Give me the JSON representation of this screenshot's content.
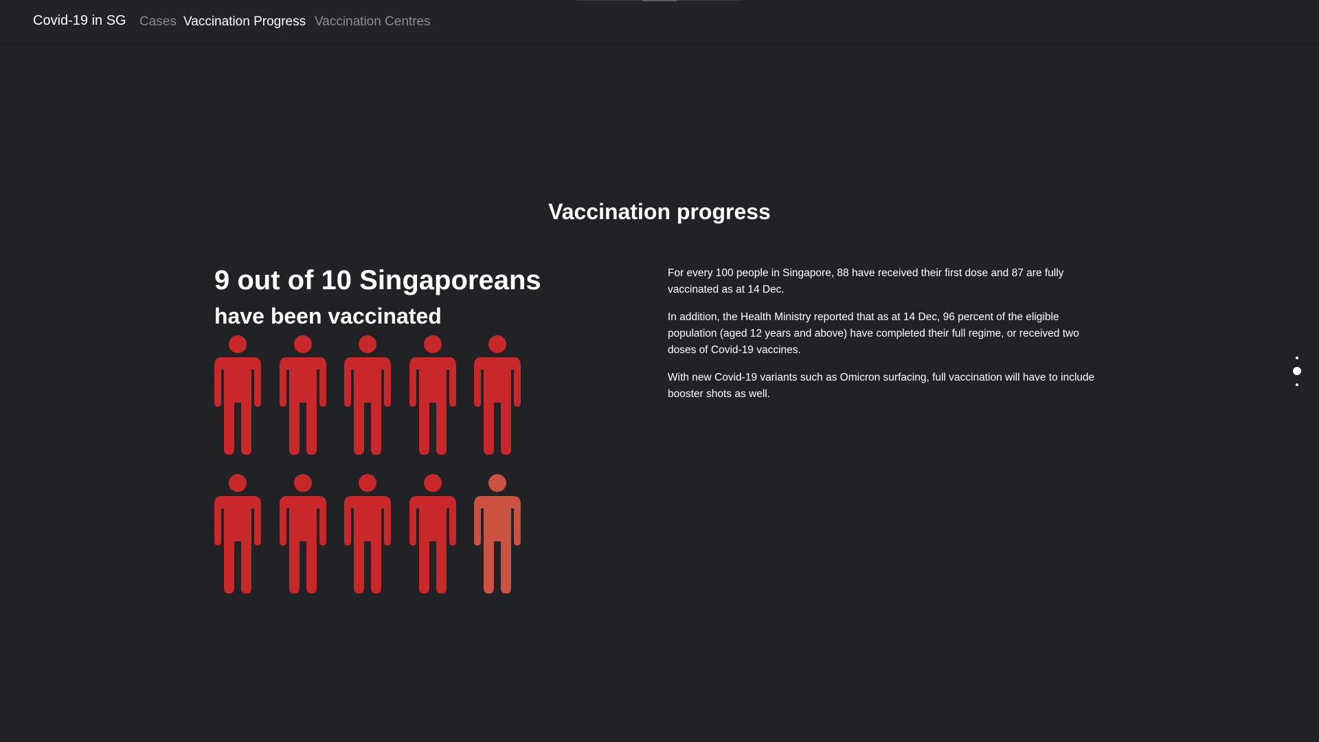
{
  "nav": {
    "brand": "Covid-19 in SG",
    "links": [
      {
        "label": "Cases",
        "active": false
      },
      {
        "label": "Vaccination Progress",
        "active": true
      },
      {
        "label": "Vaccination Centres",
        "active": false
      }
    ]
  },
  "section": {
    "title": "Vaccination progress",
    "headline": "9 out of 10 Singaporeans",
    "subheadline": "have been vaccinated"
  },
  "pictogram": {
    "total": 10,
    "vaccinated": 9,
    "icon": "person-icon",
    "colors": {
      "vaccinated": "#c8282a",
      "unvaccinated": "#c95340"
    }
  },
  "paragraphs": [
    "For every 100 people in Singapore, 88 have received their first dose and 87 are fully vaccinated as at 14 Dec.",
    "In addition, the Health Ministry reported that as at 14 Dec, 96 percent of the eligible population (aged 12 years and above) have completed their full regime, or received two doses of Covid-19 vaccines.",
    "With new Covid-19 variants such as Omicron surfacing, full vaccination will have to include booster shots as well."
  ],
  "page_dots": {
    "count": 3,
    "active_index": 1
  },
  "colors": {
    "background": "#212226",
    "text": "#ffffff",
    "nav_inactive": "#8b8c90"
  }
}
